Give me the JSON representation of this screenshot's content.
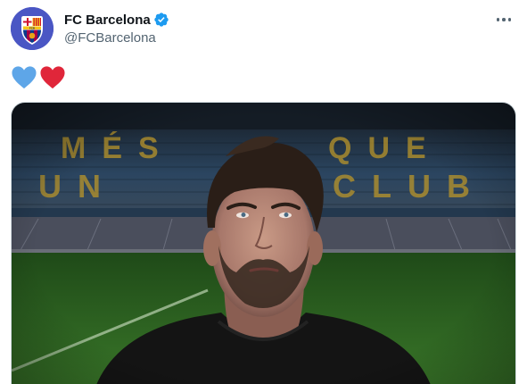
{
  "account": {
    "display_name": "FC Barcelona",
    "handle": "@FCBarcelona",
    "verified": true,
    "avatar_icon": "fc-barcelona-crest-icon",
    "avatar_bg": "#4a56c4"
  },
  "tweet": {
    "content_icons": [
      "blue-heart-icon",
      "red-heart-icon"
    ],
    "colors": {
      "blue_heart": "#5ea6e8",
      "red_heart": "#e0263a"
    }
  },
  "media": {
    "stand_lettering_row1": "MÉS QUE",
    "stand_lettering_row2": "UN CLUB",
    "seat_color": "#2d4f72",
    "letter_color": "#b9952a",
    "pitch_color": "#2d6b23"
  },
  "menu": {
    "more_icon": "more-options-icon"
  }
}
